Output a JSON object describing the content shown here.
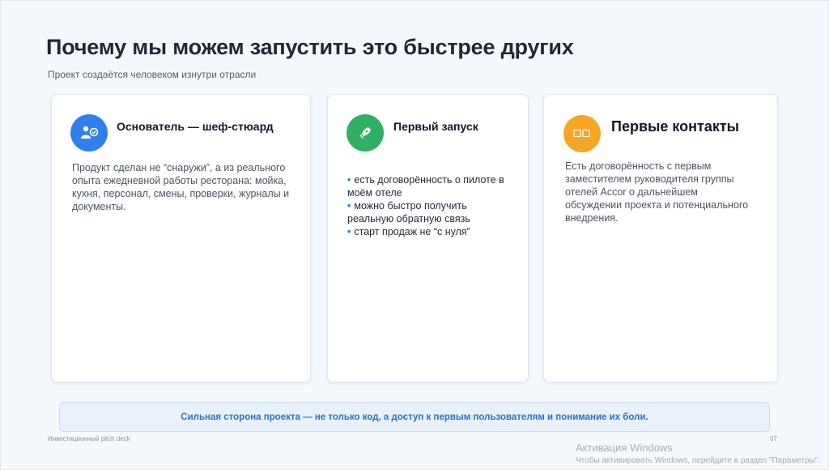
{
  "slide": {
    "title": "Почему мы можем запустить это быстрее других",
    "subtitle": "Проект создаётся человеком изнутри отрасли"
  },
  "cards": [
    {
      "icon": "chef-user-icon",
      "color": "#2f80ed",
      "title": "Основатель — шеф-стюард",
      "text": "Продукт сделан не “снаружи”, а из реального опыта ежедневной работы ресторана: мойка, кухня, персонал, смены, проверки, журналы и документы."
    },
    {
      "icon": "rocket-icon",
      "color": "#2fb063",
      "title": "Первый запуск",
      "bullets": [
        "есть договорённость о пилоте в моём отеле",
        "можно быстро получить реальную обратную связь",
        "старт продаж не “с нуля”"
      ]
    },
    {
      "icon": "contacts-icon",
      "color": "#f5a623",
      "title": "Первые контакты",
      "text": "Есть договорённость с первым заместителем руководителя группы отелей Accor о дальнейшем обсуждении проекта и потенциального внедрения."
    }
  ],
  "banner": {
    "text": "Сильная сторона проекта — не только код, а доступ к первым пользователям и понимание их боли."
  },
  "footer": {
    "left": "Инвестиционный pitch deck",
    "page": "07"
  },
  "watermark": {
    "title": "Активация Windows",
    "hint": "Чтобы активировать Windows, перейдите в раздел \"Параметры\"."
  }
}
